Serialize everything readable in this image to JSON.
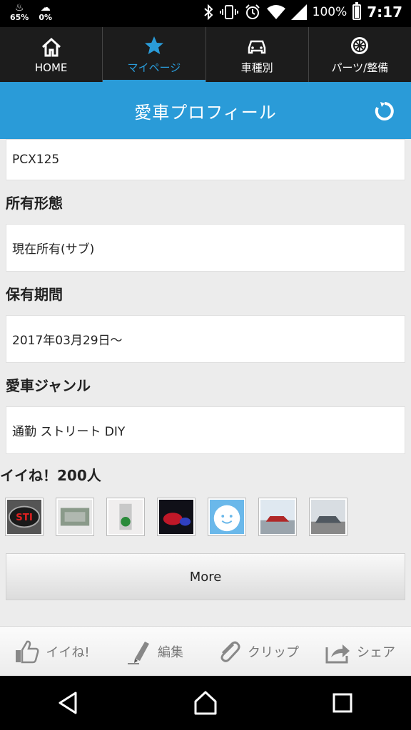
{
  "status_bar": {
    "left_1_glyph": "♨",
    "left_1_value": "65%",
    "left_2_glyph": "☁",
    "left_2_value": "0%",
    "bluetooth_icon": "bluetooth-icon",
    "battery_percent": "100%",
    "time": "7:17"
  },
  "top_nav": {
    "items": [
      {
        "icon": "home-icon",
        "label": "HOME"
      },
      {
        "icon": "star-icon",
        "label": "マイページ"
      },
      {
        "icon": "car-icon",
        "label": "車種別"
      },
      {
        "icon": "wheel-icon",
        "label": "パーツ/整備"
      }
    ],
    "active_color": "#2a9bd8"
  },
  "header": {
    "title": "愛車プロフィール",
    "background": "#2a9bd8"
  },
  "profile": {
    "model_value": "PCX125",
    "ownership_label": "所有形態",
    "ownership_value": "現在所有(サブ)",
    "period_label": "保有期間",
    "period_value": "2017年03月29日〜",
    "genre_label": "愛車ジャンル",
    "genre_value": "通勤 ストリート DIY"
  },
  "likes": {
    "title": "イイね！200人"
  },
  "more_button": {
    "label": "More"
  },
  "toolbar": {
    "like": "イイね!",
    "edit": "編集",
    "clip": "クリップ",
    "share": "シェア"
  }
}
